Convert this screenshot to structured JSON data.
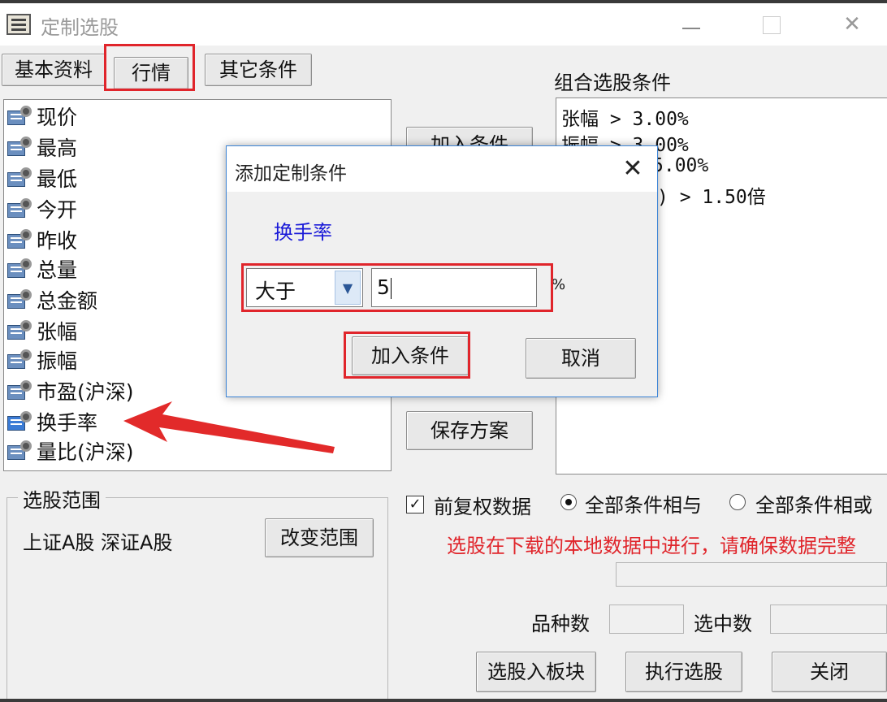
{
  "window": {
    "title": "定制选股"
  },
  "tabs": [
    {
      "label": "基本资料"
    },
    {
      "label": "行情"
    },
    {
      "label": "其它条件"
    }
  ],
  "indicator_list": [
    "现价",
    "最高",
    "最低",
    "今开",
    "昨收",
    "总量",
    "总金额",
    "张幅",
    "振幅",
    "市盈(沪深)",
    "换手率",
    "量比(沪深)"
  ],
  "buttons": {
    "add_condition_behind": "加入条件",
    "save_plan": "保存方案",
    "change_range": "改变范围",
    "to_block": "选股入板块",
    "execute": "执行选股",
    "close": "关闭"
  },
  "combined": {
    "heading": "组合选股条件",
    "conditions": [
      "张幅 > 3.00%",
      "振幅 > 3.00%",
      "5.00%",
      ") > 1.50倍"
    ]
  },
  "range": {
    "legend": "选股范围",
    "markets": "上证A股  深证A股"
  },
  "options": {
    "checkbox_label": "前复权数据",
    "checkbox_checked": true,
    "radio_and": "全部条件相与",
    "radio_or": "全部条件相或",
    "warning": "选股在下载的本地数据中进行，请确保数据完整",
    "warning_color": "#e0252b"
  },
  "counts": {
    "variety_label": "品种数",
    "selected_label": "选中数"
  },
  "dialog": {
    "title": "添加定制条件",
    "field_name": "换手率",
    "field_name_color": "#1a1ad8",
    "operator": "大于",
    "value": "5",
    "unit": "%",
    "add_button": "加入条件",
    "cancel_button": "取消"
  },
  "icons": {
    "list_item_icon": "indicator-card-icon",
    "dropdown": "chevron-down-icon",
    "close": "close-icon",
    "annotation": "red-arrow-icon"
  }
}
